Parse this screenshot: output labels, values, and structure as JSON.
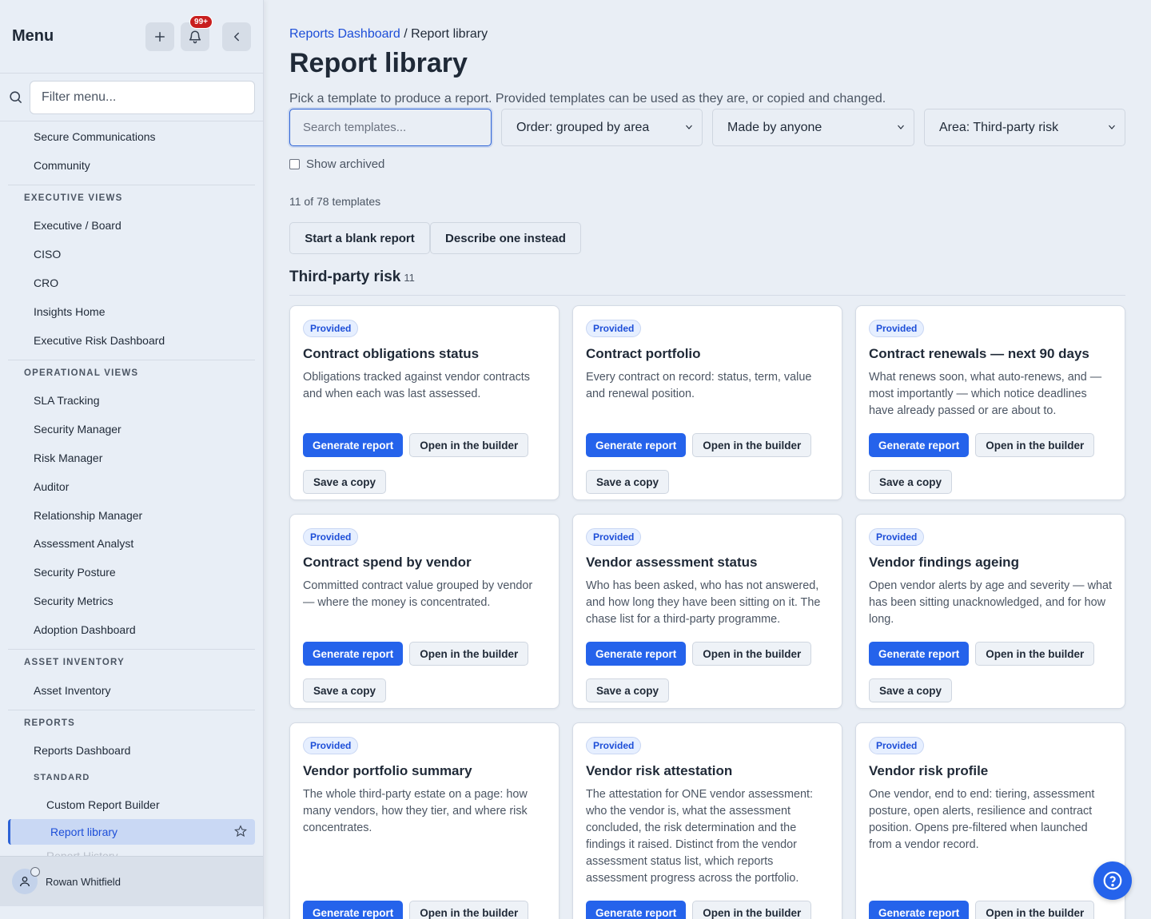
{
  "sidebar": {
    "title": "Menu",
    "notification_count": "99+",
    "filter_placeholder": "Filter menu...",
    "top_items": [
      "Secure Communications",
      "Community"
    ],
    "executive_views": {
      "label": "EXECUTIVE VIEWS",
      "items": [
        "Executive / Board",
        "CISO",
        "CRO",
        "Insights Home",
        "Executive Risk Dashboard"
      ]
    },
    "operational_views": {
      "label": "OPERATIONAL VIEWS",
      "items": [
        "SLA Tracking",
        "Security Manager",
        "Risk Manager",
        "Auditor",
        "Relationship Manager",
        "Assessment Analyst",
        "Security Posture",
        "Security Metrics",
        "Adoption Dashboard"
      ]
    },
    "asset_inventory": {
      "label": "ASSET INVENTORY",
      "items": [
        "Asset Inventory"
      ]
    },
    "reports": {
      "label": "REPORTS",
      "items": [
        "Reports Dashboard"
      ],
      "standard_label": "STANDARD",
      "standard_items": [
        "Custom Report Builder",
        "Report library",
        "Report History"
      ]
    },
    "user_name": "Rowan Whitfield"
  },
  "main": {
    "breadcrumb_link": "Reports Dashboard",
    "breadcrumb_sep": " / ",
    "breadcrumb_current": "Report library",
    "title": "Report library",
    "description": "Pick a template to produce a report. Provided templates can be used as they are, or copied and changed.",
    "search_placeholder": "Search templates...",
    "order_select": "Order: grouped by area",
    "made_by_select": "Made by anyone",
    "area_select": "Area: Third-party risk",
    "show_archived": "Show archived",
    "count_text": "11 of 78 templates",
    "blank_btn": "Start a blank report",
    "describe_btn": "Describe one instead",
    "section_title": "Third-party risk",
    "section_count": "11"
  },
  "card_labels": {
    "badge": "Provided",
    "generate": "Generate report",
    "builder": "Open in the builder",
    "copy": "Save a copy"
  },
  "cards": [
    {
      "title": "Contract obligations status",
      "desc": "Obligations tracked against vendor contracts and when each was last assessed."
    },
    {
      "title": "Contract portfolio",
      "desc": "Every contract on record: status, term, value and renewal position."
    },
    {
      "title": "Contract renewals — next 90 days",
      "desc": "What renews soon, what auto-renews, and — most importantly — which notice deadlines have already passed or are about to."
    },
    {
      "title": "Contract spend by vendor",
      "desc": "Committed contract value grouped by vendor — where the money is concentrated."
    },
    {
      "title": "Vendor assessment status",
      "desc": "Who has been asked, who has not answered, and how long they have been sitting on it. The chase list for a third-party programme."
    },
    {
      "title": "Vendor findings ageing",
      "desc": "Open vendor alerts by age and severity — what has been sitting unacknowledged, and for how long."
    },
    {
      "title": "Vendor portfolio summary",
      "desc": "The whole third-party estate on a page: how many vendors, how they tier, and where risk concentrates."
    },
    {
      "title": "Vendor risk attestation",
      "desc": "The attestation for ONE vendor assessment: who the vendor is, what the assessment concluded, the risk determination and the findings it raised. Distinct from the vendor assessment status list, which reports assessment progress across the portfolio."
    },
    {
      "title": "Vendor risk profile",
      "desc": "One vendor, end to end: tiering, assessment posture, open alerts, resilience and contract position. Opens pre-filtered when launched from a vendor record."
    }
  ]
}
